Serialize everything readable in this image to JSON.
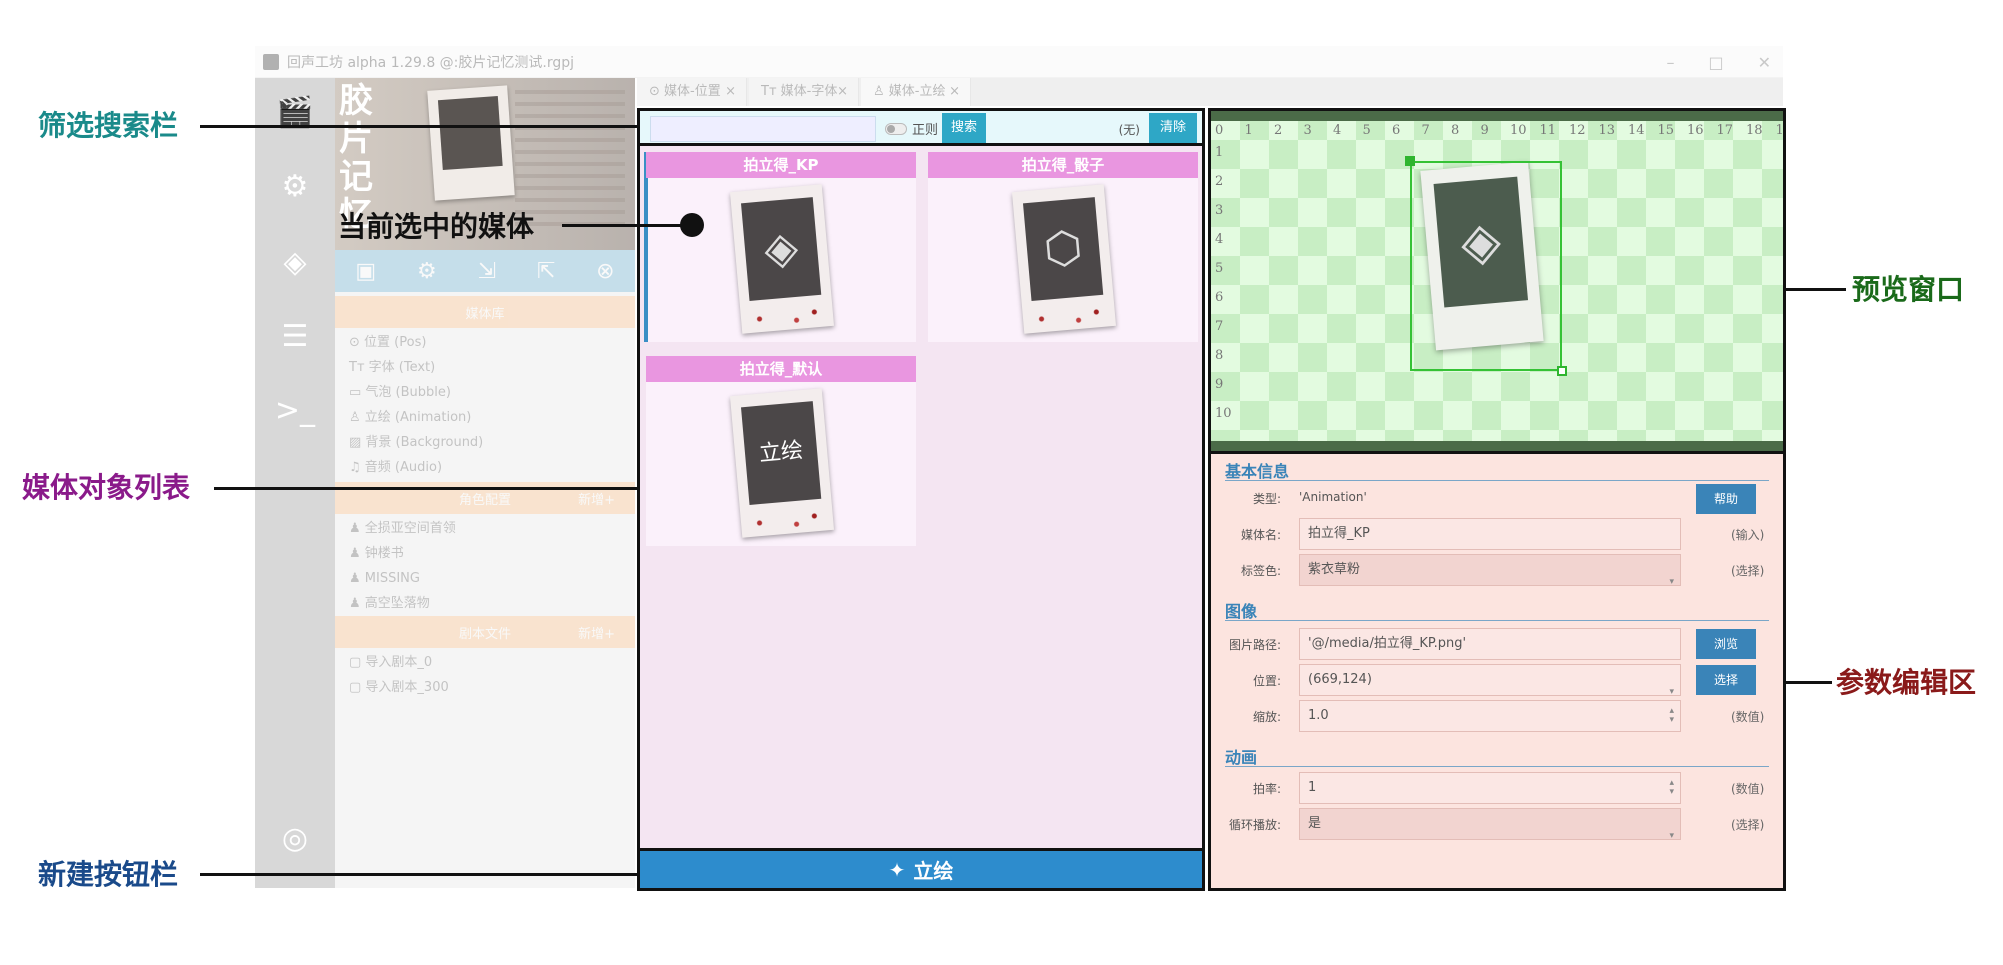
{
  "window": {
    "title": "回声工坊 alpha 1.29.8 @:胶片记忆测试.rgpj",
    "minimize": "–",
    "maximize": "□",
    "close": "✕"
  },
  "sidebar": {
    "banner_title": "胶片记忆",
    "sections": [
      {
        "header": "媒体库",
        "items": [
          "位置 (Pos)",
          "字体 (Text)",
          "气泡 (Bubble)",
          "立绘 (Animation)",
          "背景 (Background)",
          "音频 (Audio)"
        ]
      },
      {
        "header": "角色配置",
        "add": "新增+",
        "items": [
          "全损亚空间首领",
          "钟楼书",
          "MISSING",
          "高空坠落物"
        ]
      },
      {
        "header": "剧本文件",
        "add": "新增+",
        "items": [
          "导入剧本_0",
          "导入剧本_300"
        ]
      }
    ]
  },
  "tabs": [
    {
      "icon": "⊙",
      "label": "媒体-位置",
      "close": "×"
    },
    {
      "icon": "Tт",
      "label": "媒体-字体",
      "close": "×"
    },
    {
      "icon": "♙",
      "label": "媒体-立绘",
      "close": "×"
    }
  ],
  "filter": {
    "placeholder": "",
    "regex_label": "正则",
    "search_button": "搜索",
    "none_label": "(无)",
    "clear_button": "清除"
  },
  "media": [
    {
      "name": "拍立得_KP",
      "symbol": "◈"
    },
    {
      "name": "拍立得_骰子",
      "symbol": "⬡"
    },
    {
      "name": "拍立得_默认",
      "symbol": "立绘"
    }
  ],
  "new_button": {
    "icon": "✦",
    "label": "立绘"
  },
  "preview": {
    "x_ticks": [
      "0",
      "1",
      "2",
      "3",
      "4",
      "5",
      "6",
      "7",
      "8",
      "9",
      "10",
      "11",
      "12",
      "13",
      "14",
      "15",
      "16",
      "17",
      "18",
      "1"
    ],
    "y_ticks": [
      "1",
      "2",
      "3",
      "4",
      "5",
      "6",
      "7",
      "8",
      "9",
      "10"
    ]
  },
  "params": {
    "sections": {
      "basic": "基本信息",
      "image": "图像",
      "animation": "动画"
    },
    "fields": [
      {
        "label": "类型:",
        "value": "'Animation'",
        "button": "帮助"
      },
      {
        "label": "媒体名:",
        "value": "拍立得_KP",
        "hint": "(输入)"
      },
      {
        "label": "标签色:",
        "value": "紫衣草粉",
        "hint": "(选择)"
      },
      {
        "label": "图片路径:",
        "value": "'@/media/拍立得_KP.png'",
        "button": "浏览"
      },
      {
        "label": "位置:",
        "value": "(669,124)",
        "button": "选择"
      },
      {
        "label": "缩放:",
        "value": "1.0",
        "hint": "(数值)"
      },
      {
        "label": "拍率:",
        "value": "1",
        "hint": "(数值)"
      },
      {
        "label": "循环播放:",
        "value": "是",
        "hint": "(选择)"
      }
    ]
  },
  "callouts": {
    "filter": "筛选搜索栏",
    "selected": "当前选中的媒体",
    "list": "媒体对象列表",
    "newbar": "新建按钮栏",
    "preview": "预览窗口",
    "params": "参数编辑区"
  },
  "colors": {
    "filter_callout": "#1a8a8a",
    "list_callout": "#8a1a8a",
    "newbar_callout": "#1a4a8a",
    "preview_callout": "#1a6a1a",
    "params_callout": "#8a1a1a",
    "media_header": "#e996e0",
    "new_bar": "#2d8ccd"
  }
}
